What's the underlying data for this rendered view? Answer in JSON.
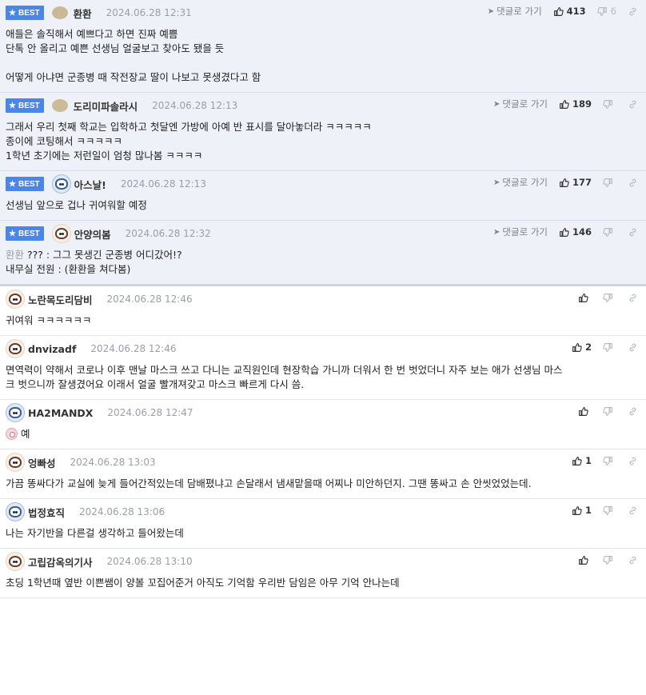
{
  "labels": {
    "best": "BEST",
    "reply": "댓글로 가기"
  },
  "icons": {
    "best_star": "star-icon",
    "reply_arrow": "reply-arrow-icon",
    "like": "thumbs-up-icon",
    "dislike": "thumbs-down-icon",
    "link": "link-icon"
  },
  "colors": {
    "best_badge": "#4a86e8",
    "best_background": "#eef1f8",
    "date_text": "#9a9ea6"
  },
  "comments": [
    {
      "best": true,
      "avatar": "blob",
      "nick": "환환",
      "date": "2024.06.28 12:31",
      "likes": "413",
      "dislikes": "6",
      "lines": [
        "애들은 솔직해서 예쁘다고 하면 진짜 예쁨",
        "단톡 안 올리고 예쁜 선생님 얼굴보고 찾아도 됐을 듯",
        "",
        "어떻게 아냐면 군종병 때 작전장교 딸이 나보고 못생겼다고 함"
      ]
    },
    {
      "best": true,
      "avatar": "blob",
      "nick": "도리미파솔라시",
      "date": "2024.06.28 12:13",
      "likes": "189",
      "dislikes": "",
      "lines": [
        "그래서 우리 첫째 학교는 입학하고 첫달엔 가방에 아예 반 표시를 달아놓더라 ㅋㅋㅋㅋㅋ",
        "종이에 코팅해서 ㅋㅋㅋㅋㅋ",
        "1학년 초기에는 저런일이 엄청 많나봄 ㅋㅋㅋㅋ"
      ]
    },
    {
      "best": true,
      "avatar": "blue",
      "nick": "아스날!",
      "date": "2024.06.28 12:13",
      "likes": "177",
      "dislikes": "",
      "lines": [
        "선생님 앞으로 겁나 귀여워할 예정"
      ]
    },
    {
      "best": true,
      "avatar": "dog",
      "nick": "안양의봄",
      "date": "2024.06.28 12:32",
      "likes": "146",
      "dislikes": "",
      "mention": "환환",
      "lines": [
        "??? : 그그 못생긴 군종병 어디갔어!?",
        "내무실 전원 : (환환을 쳐다봄)"
      ]
    },
    {
      "best": false,
      "avatar": "dog",
      "nick": "노란목도리담비",
      "date": "2024.06.28 12:46",
      "likes": "",
      "dislikes": "",
      "lines": [
        "귀여워 ㅋㅋㅋㅋㅋㅋ"
      ]
    },
    {
      "best": false,
      "avatar": "dog",
      "nick": "dnvizadf",
      "date": "2024.06.28 12:46",
      "likes": "2",
      "dislikes": "",
      "lines": [
        "면역력이 약해서 코로나 이후 맨날 마스크 쓰고 다니는 교직원인데 현장학습 가니까 더워서 한 번 벗었더니 자주 보는 애가 선생님 마스",
        "크 벗으니까 잘생겼어요 이래서 얼굴 빨개져갖고 마스크 빠르게 다시 씀."
      ]
    },
    {
      "best": false,
      "avatar": "blue",
      "nick": "HA2MANDX",
      "date": "2024.06.28 12:47",
      "likes": "",
      "dislikes": "",
      "emoji": "pig-face-emoji",
      "lines": [
        "예"
      ]
    },
    {
      "best": false,
      "avatar": "dog",
      "nick": "엉빠성",
      "date": "2024.06.28 13:03",
      "likes": "1",
      "dislikes": "",
      "lines": [
        "가끔 똥싸다가 교실에 늦게 들어간적있는데 담배폈냐고 손달래서 냄새맡을때 어찌나 미안하던지. 그땐 똥싸고 손 안씻었었는데."
      ]
    },
    {
      "best": false,
      "avatar": "blue",
      "nick": "법정효직",
      "date": "2024.06.28 13:06",
      "likes": "1",
      "dislikes": "",
      "lines": [
        "나는 자기반을 다른걸 생각하고 들어왔는데"
      ]
    },
    {
      "best": false,
      "avatar": "dog",
      "nick": "고립감옥의기사",
      "date": "2024.06.28 13:10",
      "likes": "",
      "dislikes": "",
      "lines": [
        "초딩 1학년때 옆반 이쁜쌤이 양볼 꼬집어준거 아직도 기억함 우리반 담임은 아무 기억 안나는데"
      ]
    }
  ]
}
